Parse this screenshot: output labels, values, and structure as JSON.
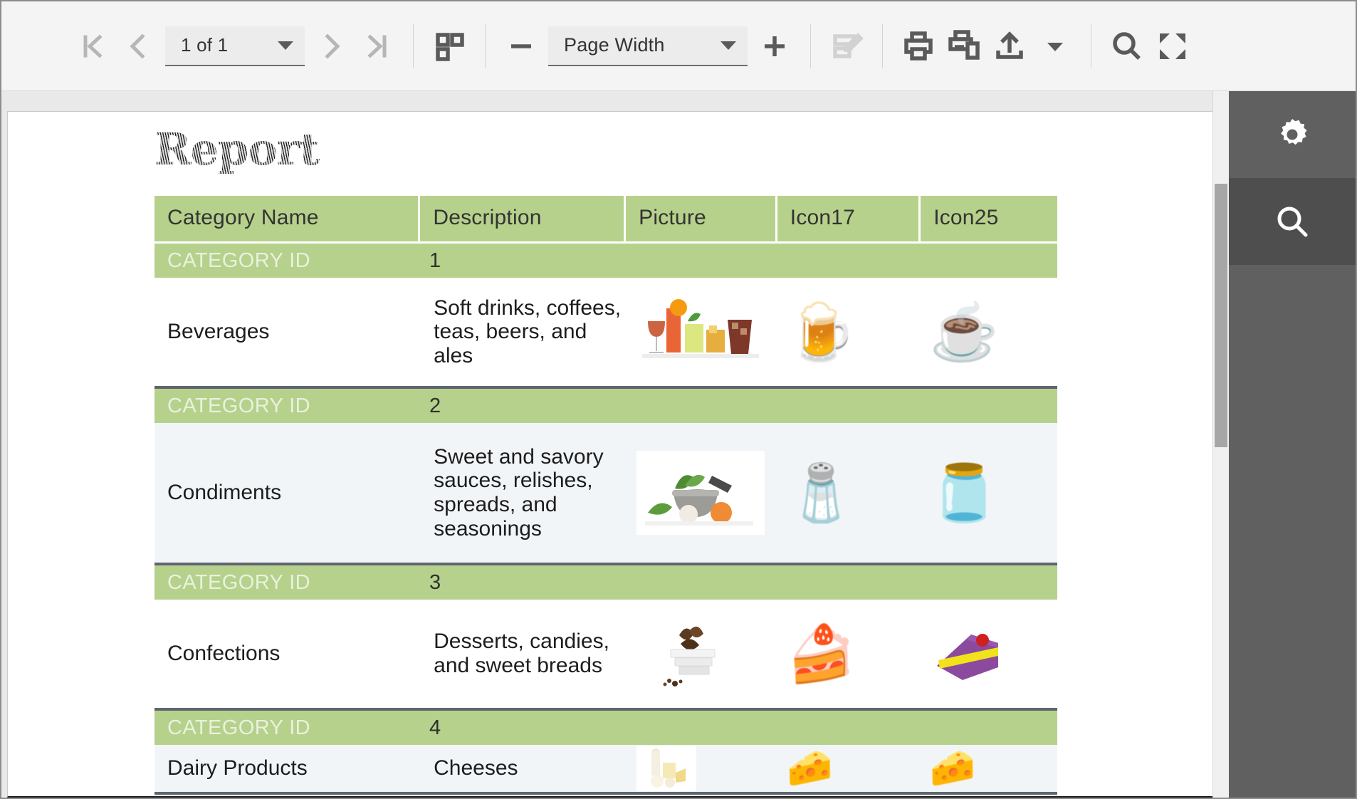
{
  "toolbar": {
    "nav": {
      "first_page_label": "First Page",
      "prev_page_label": "Previous Page",
      "next_page_label": "Next Page",
      "last_page_label": "Last Page"
    },
    "page_selector": {
      "value": "1 of 1",
      "icon": "chevron-down-icon"
    },
    "page_layout_label": "Page Layout",
    "zoom_out_label": "Zoom Out",
    "zoom_selector": {
      "value": "Page Width",
      "icon": "chevron-down-icon"
    },
    "zoom_in_label": "Zoom In",
    "edit_label": "Edit Report",
    "print_label": "Print",
    "print_multiple_label": "Print Multiple",
    "export_label": "Export",
    "more_label": "More",
    "search_label": "Search",
    "fullscreen_label": "Full Screen"
  },
  "sidepanel": {
    "items": [
      {
        "name": "parameters",
        "icon": "gear-icon",
        "active": false
      },
      {
        "name": "search",
        "icon": "search-icon",
        "active": true
      }
    ]
  },
  "document": {
    "title": "Report",
    "table": {
      "columns": [
        {
          "key": "name",
          "label": "Category Name"
        },
        {
          "key": "desc",
          "label": "Description"
        },
        {
          "key": "pic",
          "label": "Picture"
        },
        {
          "key": "i17",
          "label": "Icon17"
        },
        {
          "key": "i25",
          "label": "Icon25"
        }
      ],
      "group_label": "CATEGORY ID",
      "groups": [
        {
          "id": "1",
          "name": "Beverages",
          "description": "Soft drinks, coffees, teas, beers, and ales",
          "picture_alt": "assorted-cocktails-photo",
          "icon17": "🍺",
          "icon17_alt": "beer-mug-icon",
          "icon25": "☕",
          "icon25_alt": "teacup-icon",
          "shaded": false
        },
        {
          "id": "2",
          "name": "Condiments",
          "description": "Sweet and savory sauces, relishes, spreads, and seasonings",
          "picture_alt": "mortar-and-pestle-photo",
          "icon17": "🧂",
          "icon17_alt": "salt-shaker-icon",
          "icon25": "🫙",
          "icon25_alt": "spice-jars-icon",
          "shaded": true
        },
        {
          "id": "3",
          "name": "Confections",
          "description": "Desserts, candies, and sweet breads",
          "picture_alt": "chocolate-truffles-photo",
          "icon17": "🍰",
          "icon17_alt": "chocolate-cake-slice-icon",
          "icon25": "🍰",
          "icon25_alt": "purple-cake-slice-icon",
          "shaded": false
        },
        {
          "id": "4",
          "name": "Dairy Products",
          "description": "Cheeses",
          "picture_alt": "cheese-and-milk-photo",
          "icon17": "🧀",
          "icon17_alt": "cheese-wedge-icon",
          "icon25": "🧀",
          "icon25_alt": "cheese-wedge-icon",
          "shaded": true
        }
      ]
    }
  },
  "colors": {
    "header_green": "#b6d18b",
    "row_alt": "#f2f5f8",
    "row_divider": "#5d6670",
    "panel_dark": "#606060",
    "toolbar_bg": "#f4f4f4"
  }
}
